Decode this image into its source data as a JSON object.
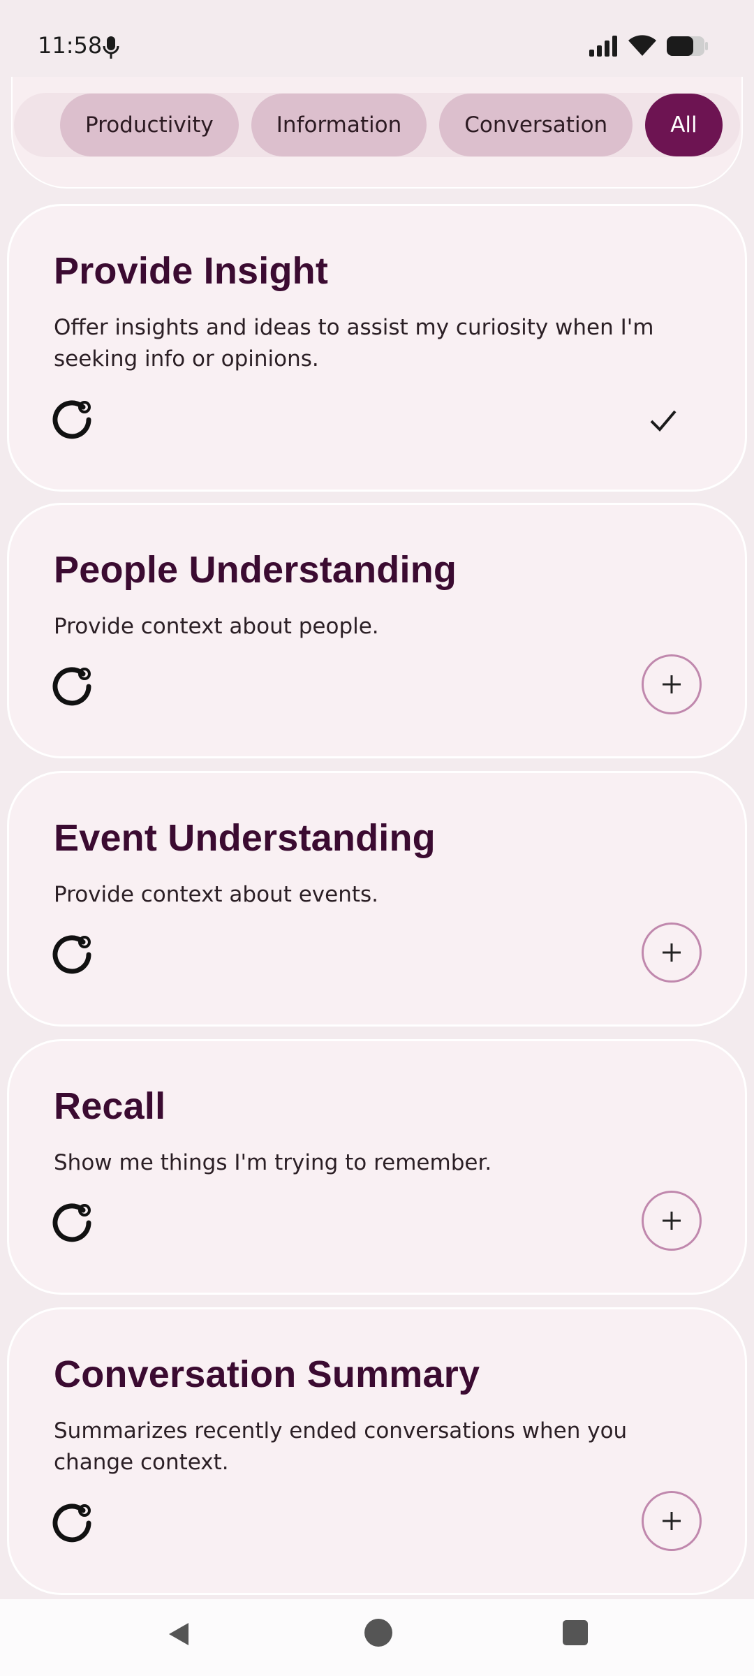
{
  "status_bar": {
    "time": "11:58"
  },
  "filters": {
    "chips": [
      {
        "label": "Productivity",
        "selected": false
      },
      {
        "label": "Information",
        "selected": false
      },
      {
        "label": "Conversation",
        "selected": false
      },
      {
        "label": "All",
        "selected": true
      }
    ]
  },
  "cards": [
    {
      "title": "Provide Insight",
      "description": "Offer insights and ideas to assist my curiosity when I'm seeking info or opinions.",
      "state": "added",
      "icon": "refresh-icon"
    },
    {
      "title": "People Understanding",
      "description": "Provide context about people.",
      "state": "available",
      "icon": "refresh-icon"
    },
    {
      "title": "Event Understanding",
      "description": "Provide context about events.",
      "state": "available",
      "icon": "refresh-icon"
    },
    {
      "title": "Recall",
      "description": "Show me things I'm trying to remember.",
      "state": "available",
      "icon": "refresh-icon"
    },
    {
      "title": "Conversation Summary",
      "description": "Summarizes recently ended conversations when you change context.",
      "state": "available",
      "icon": "refresh-icon"
    }
  ],
  "colors": {
    "accent": "#6d1452",
    "chip": "#dcbfcd",
    "title": "#3b0b31",
    "card_bg": "#f9f0f3",
    "page_bg": "#f3ebee"
  }
}
